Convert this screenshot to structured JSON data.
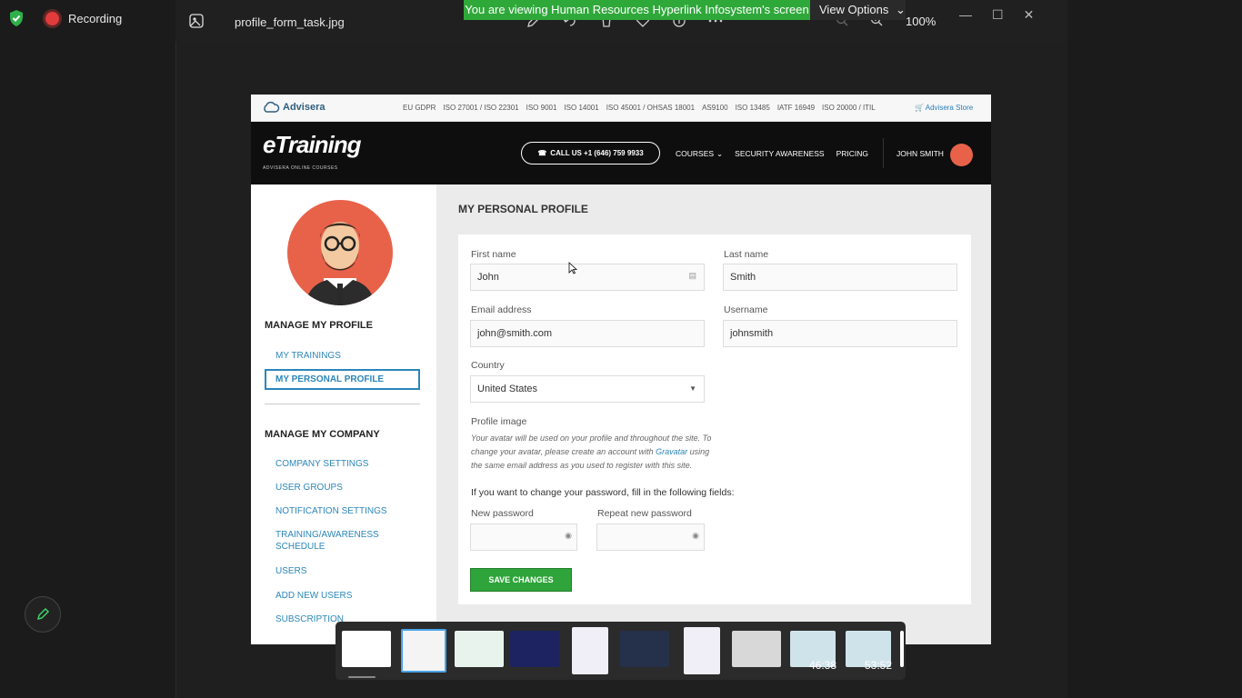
{
  "recording": {
    "label": "Recording"
  },
  "viewer": {
    "filename": "profile_form_task.jpg",
    "zoom": "100%",
    "share_banner": "You are viewing Human Resources Hyperlink Infosystem's screen",
    "view_options": "View Options"
  },
  "site": {
    "brand": "Advisera",
    "standards": [
      "EU GDPR",
      "ISO 27001 / ISO 22301",
      "ISO 9001",
      "ISO 14001",
      "ISO 45001 / OHSAS 18001",
      "AS9100",
      "ISO 13485",
      "IATF 16949",
      "ISO 20000 / ITIL"
    ],
    "store": "Advisera Store",
    "logo": "eTraining",
    "logo_sub": "ADVISERA ONLINE COURSES",
    "call": "CALL US +1 (646) 759 9933",
    "nav": [
      "COURSES",
      "SECURITY AWARENESS",
      "PRICING"
    ],
    "user": "JOHN SMITH"
  },
  "sidebar": {
    "manage_profile": "MANAGE MY PROFILE",
    "my_trainings": "MY TRAININGS",
    "my_personal_profile": "MY PERSONAL PROFILE",
    "manage_company": "MANAGE MY COMPANY",
    "company_items": [
      "COMPANY SETTINGS",
      "USER GROUPS",
      "NOTIFICATION SETTINGS",
      "TRAINING/AWARENESS SCHEDULE",
      "USERS",
      "ADD NEW USERS",
      "SUBSCRIPTION"
    ]
  },
  "form": {
    "title": "MY PERSONAL PROFILE",
    "first_name_label": "First name",
    "first_name": "John",
    "last_name_label": "Last name",
    "last_name": "Smith",
    "email_label": "Email address",
    "email": "john@smith.com",
    "username_label": "Username",
    "username": "johnsmith",
    "country_label": "Country",
    "country": "United States",
    "profile_image_label": "Profile image",
    "profile_note_1": "Your avatar will be used on your profile and throughout the site. To",
    "profile_note_2a": "change your avatar, please create an account with ",
    "profile_note_link": "Gravatar",
    "profile_note_2b": " using",
    "profile_note_3": "the same email address as you used to register with this site.",
    "password_hint": "If you want to change your password, fill in the following fields:",
    "new_password_label": "New password",
    "repeat_password_label": "Repeat new password",
    "save": "SAVE CHANGES"
  },
  "filmstrip": {
    "times": [
      "46:38",
      "53:52"
    ]
  }
}
